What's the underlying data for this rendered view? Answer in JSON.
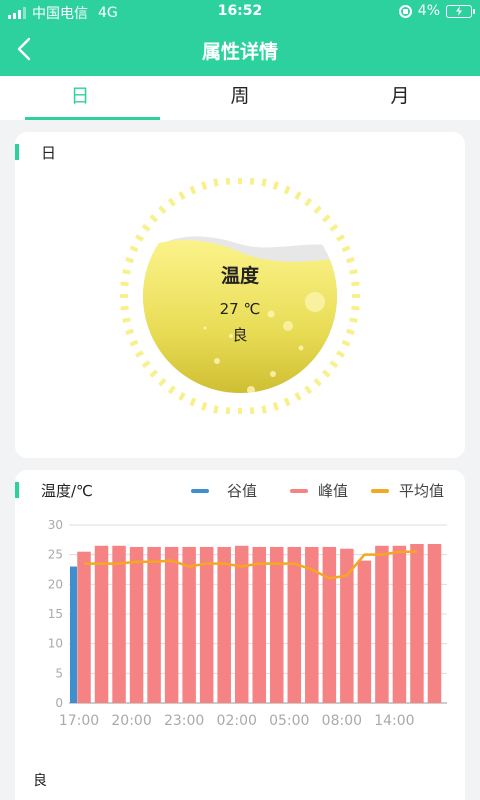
{
  "status_bar": {
    "carrier": "中国电信",
    "network": "4G",
    "time": "16:52",
    "battery": "4%"
  },
  "header": {
    "title": "属性详情"
  },
  "tabs": [
    {
      "label": "日",
      "active": true
    },
    {
      "label": "周",
      "active": false
    },
    {
      "label": "月",
      "active": false
    }
  ],
  "summary_card": {
    "title": "日",
    "gauge": {
      "label": "温度",
      "value": "27 ℃",
      "status": "良"
    }
  },
  "chart_card": {
    "title": "温度/℃",
    "legend": [
      {
        "label": "谷值",
        "color": "#3d8fcf"
      },
      {
        "label": "峰值",
        "color": "#f68384"
      },
      {
        "label": "平均值",
        "color": "#f5a623"
      }
    ],
    "bottom_label": "良"
  },
  "chart_data": {
    "type": "bar",
    "ylabel": "温度/℃",
    "ylim": [
      0,
      30
    ],
    "yticks": [
      0,
      5,
      10,
      15,
      20,
      25,
      30
    ],
    "xticks": [
      "17:00",
      "20:00",
      "23:00",
      "02:00",
      "05:00",
      "08:00",
      "14:00"
    ],
    "tick_index": [
      0,
      3,
      6,
      9,
      12,
      15,
      18
    ],
    "grid": true,
    "series": [
      {
        "name": "谷值",
        "color": "#3d8fcf",
        "values": [
          23,
          25,
          26,
          26,
          26,
          26,
          26,
          26,
          26,
          26,
          26,
          26,
          26,
          26,
          25.5,
          21,
          23.5,
          25,
          25,
          25.5
        ]
      },
      {
        "name": "峰值",
        "color": "#f68384",
        "values": [
          25.5,
          26.5,
          26.5,
          26.3,
          26.3,
          26.3,
          26.3,
          26.3,
          26.3,
          26.5,
          26.3,
          26.3,
          26.3,
          26.3,
          26.3,
          26,
          24,
          26.5,
          26.5,
          26.8,
          26.8
        ]
      },
      {
        "name": "平均值",
        "color": "#f5a623",
        "values": [
          23.5,
          23.5,
          23.5,
          23.8,
          23.8,
          24,
          23,
          23.5,
          23.5,
          23,
          23.5,
          23.5,
          23.5,
          22.5,
          21,
          21.5,
          25,
          25,
          25.5,
          25.5
        ]
      }
    ]
  }
}
